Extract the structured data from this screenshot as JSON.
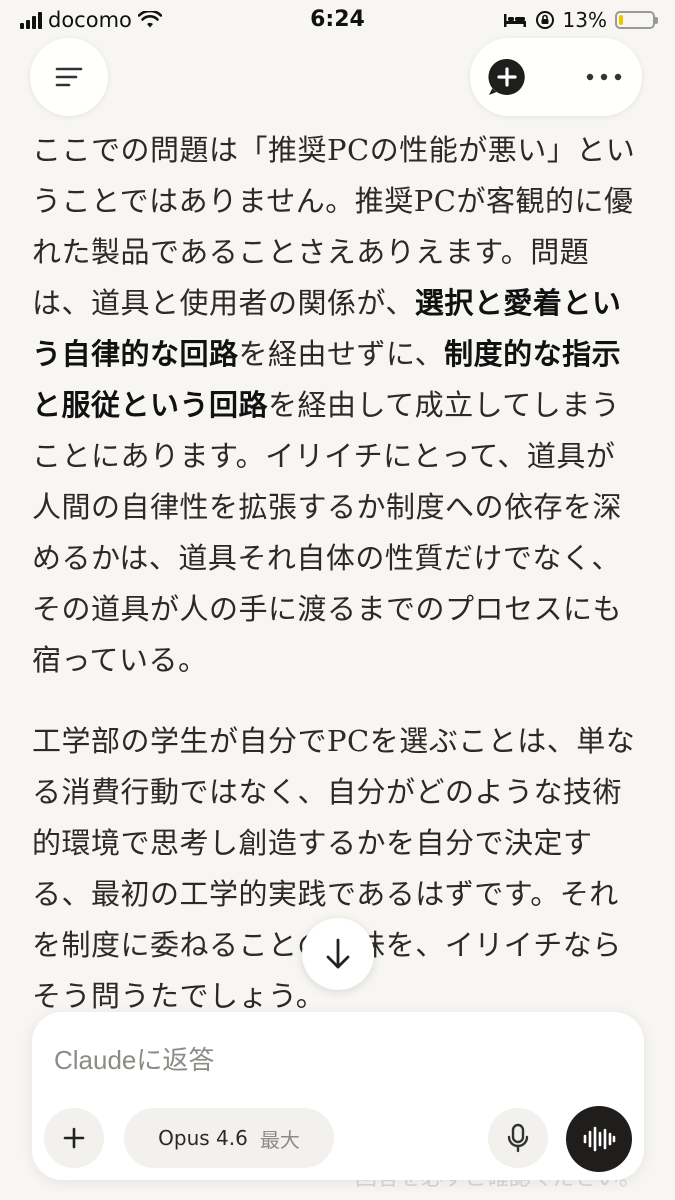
{
  "status_bar": {
    "carrier": "docomo",
    "time": "6:24",
    "battery_percent": "13%",
    "battery_level": 0.13
  },
  "icons": {
    "menu": "menu-icon",
    "new_chat": "new-chat-icon",
    "more": "more-icon",
    "scroll_down": "arrow-down-icon",
    "attach": "plus-icon",
    "mic": "mic-icon",
    "voice": "voice-wave-icon"
  },
  "message": {
    "p1_a": "ここでの問題は「推奨PCの性能が悪い」ということではありません。推奨PCが客観的に優れた製品であることさえありえます。問題は、道具と使用者の関係が、",
    "p1_b": "選択と愛着という自律的な回路",
    "p1_c": "を経由せずに、",
    "p1_d": "制度的な指示と服従という回路",
    "p1_e": "を経由して成立してしまうことにあります。イリイチにとって、道具が人間の自律性を拡張するか制度への依存を深めるかは、道具それ自体の性質だけでなく、その道具が人の手に渡るまでのプロセスにも宿っている。",
    "p2": "工学部の学生が自分でPCを選ぶことは、単なる消費行動ではなく、自分がどのような技術的環境で思考し創造するかを自分で決定する、最初の工学的実践であるはずです。それを制度に委ねることの意味を、イリイチならそう問うたでしょう。"
  },
  "behind_text": "回答を必ずご確認ください。",
  "composer": {
    "placeholder": "Claudeに返答",
    "model_name": "Opus 4.6",
    "model_tier": "最大"
  },
  "colors": {
    "background": "#f7f6f3",
    "text": "#2b2a28",
    "voice_button": "#1f1e1c",
    "battery": "#f2c400"
  }
}
